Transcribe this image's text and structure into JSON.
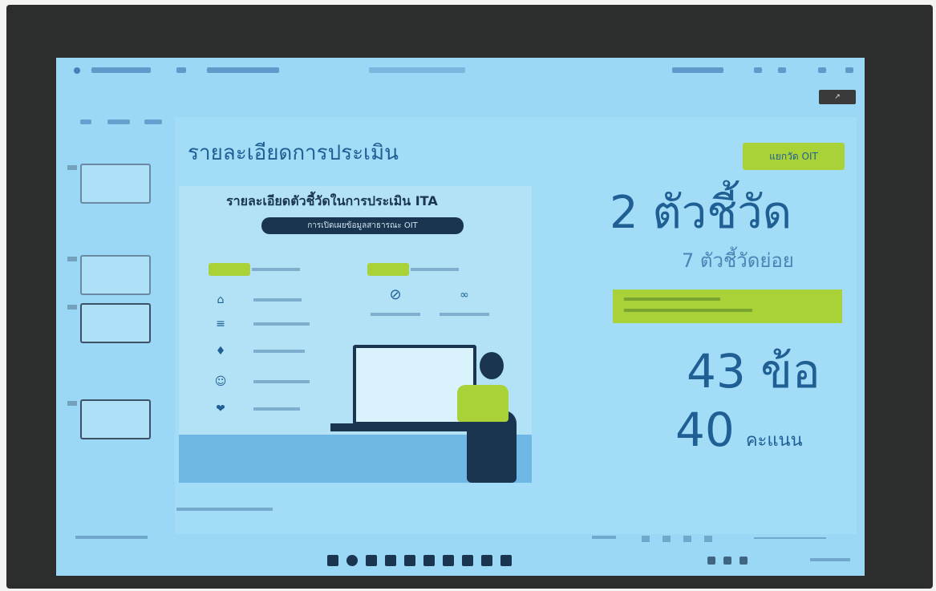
{
  "slide": {
    "title": "รายละเอียดการประเมิน",
    "badge": "แยกวัด OIT",
    "indicators": "2 ตัวชี้วัด",
    "sub_indicators": "7 ตัวชี้วัดย่อย",
    "items": "43 ข้อ",
    "score_value": "40",
    "score_unit": "คะแนน"
  },
  "infographic": {
    "heading": "รายละเอียดตัวชี้วัดในการประเมิน ITA",
    "pill": "การเปิดเผยข้อมูลสาธารณะ OIT"
  },
  "colors": {
    "screen_bg": "#9ad8f6",
    "accent_blue": "#1f5f94",
    "accent_green": "#a9d238",
    "dark_navy": "#1a3550"
  },
  "icons": [
    "app-logo-icon",
    "save-icon",
    "share-icon",
    "windows-start-icon",
    "search-icon",
    "folder-icon"
  ]
}
